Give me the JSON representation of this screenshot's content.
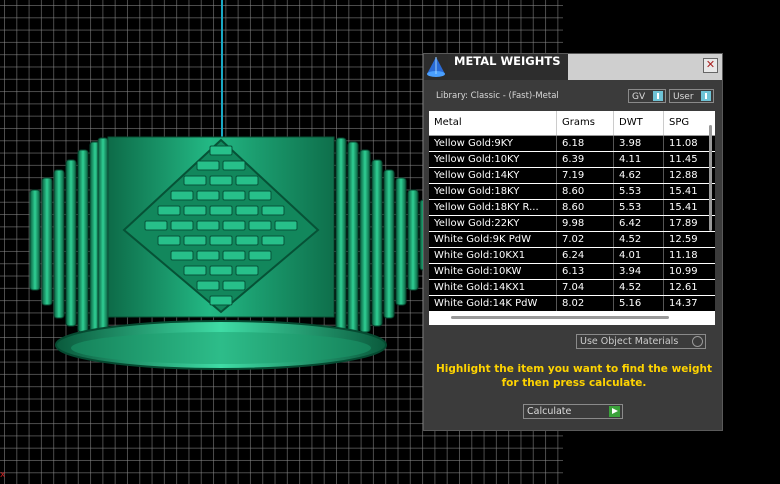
{
  "viewport": {
    "origin_marker": "x"
  },
  "panel": {
    "title": "METAL WEIGHTS",
    "close_glyph": "✕",
    "library": "Library: Classic - (Fast)-Metal",
    "toggles": [
      {
        "label": "GV"
      },
      {
        "label": "User"
      }
    ],
    "table": {
      "columns": [
        "Metal",
        "Grams",
        "DWT",
        "SPG"
      ],
      "rows": [
        [
          "Yellow Gold:9KY",
          "6.18",
          "3.98",
          "11.08"
        ],
        [
          "Yellow Gold:10KY",
          "6.39",
          "4.11",
          "11.45"
        ],
        [
          "Yellow Gold:14KY",
          "7.19",
          "4.62",
          "12.88"
        ],
        [
          "Yellow Gold:18KY",
          "8.60",
          "5.53",
          "15.41"
        ],
        [
          "Yellow Gold:18KY R...",
          "8.60",
          "5.53",
          "15.41"
        ],
        [
          "Yellow Gold:22KY",
          "9.98",
          "6.42",
          "17.89"
        ],
        [
          "White Gold:9K PdW",
          "7.02",
          "4.52",
          "12.59"
        ],
        [
          "White Gold:10KX1",
          "6.24",
          "4.01",
          "11.18"
        ],
        [
          "White Gold:10KW",
          "6.13",
          "3.94",
          "10.99"
        ],
        [
          "White Gold:14KX1",
          "7.04",
          "4.52",
          "12.61"
        ],
        [
          "White Gold:14K PdW",
          "8.02",
          "5.16",
          "14.37"
        ]
      ]
    },
    "use_object_materials": "Use Object Materials",
    "hint": "Highlight the item you want to find the weight for then press calculate.",
    "calculate": "Calculate"
  },
  "colors": {
    "ring": "#1b9e6e",
    "hint": "#ffd400",
    "accent": "#6ec3d6"
  }
}
